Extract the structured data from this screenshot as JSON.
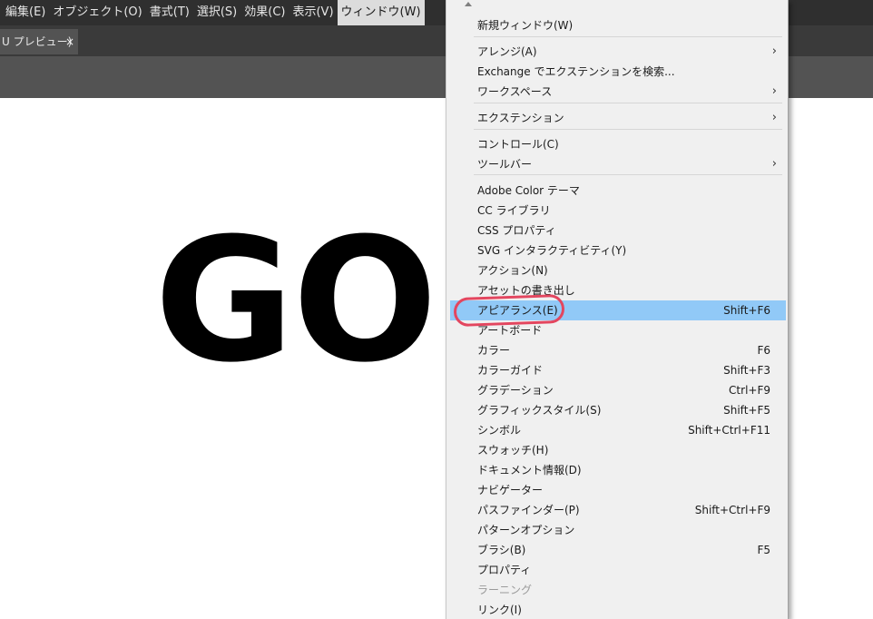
{
  "menubar": {
    "items": [
      "編集(E)",
      "オブジェクト(O)",
      "書式(T)",
      "選択(S)",
      "効果(C)",
      "表示(V)",
      "ウィンドウ(W)"
    ],
    "active_index": 6
  },
  "tab": {
    "label": "U プレビュー)",
    "close": "×"
  },
  "artwork": {
    "text": "GO"
  },
  "menu": [
    {
      "label": "新規ウィンドウ(W)",
      "shortcut": "",
      "submenu": false
    },
    {
      "label": "アレンジ(A)",
      "shortcut": "",
      "submenu": true
    },
    {
      "label": "Exchange でエクステンションを検索...",
      "shortcut": "",
      "submenu": false
    },
    {
      "label": "ワークスペース",
      "shortcut": "",
      "submenu": true
    },
    {
      "label": "エクステンション",
      "shortcut": "",
      "submenu": true
    },
    {
      "label": "コントロール(C)",
      "shortcut": "",
      "submenu": false
    },
    {
      "label": "ツールバー",
      "shortcut": "",
      "submenu": true
    },
    {
      "label": "Adobe Color テーマ",
      "shortcut": "",
      "submenu": false
    },
    {
      "label": "CC ライブラリ",
      "shortcut": "",
      "submenu": false
    },
    {
      "label": "CSS プロパティ",
      "shortcut": "",
      "submenu": false
    },
    {
      "label": "SVG インタラクティビティ(Y)",
      "shortcut": "",
      "submenu": false
    },
    {
      "label": "アクション(N)",
      "shortcut": "",
      "submenu": false
    },
    {
      "label": "アセットの書き出し",
      "shortcut": "",
      "submenu": false
    },
    {
      "label": "アピアランス(E)",
      "shortcut": "Shift+F6",
      "submenu": false,
      "highlight": true
    },
    {
      "label": "アートボード",
      "shortcut": "",
      "submenu": false
    },
    {
      "label": "カラー",
      "shortcut": "F6",
      "submenu": false
    },
    {
      "label": "カラーガイド",
      "shortcut": "Shift+F3",
      "submenu": false
    },
    {
      "label": "グラデーション",
      "shortcut": "Ctrl+F9",
      "submenu": false
    },
    {
      "label": "グラフィックスタイル(S)",
      "shortcut": "Shift+F5",
      "submenu": false
    },
    {
      "label": "シンボル",
      "shortcut": "Shift+Ctrl+F11",
      "submenu": false
    },
    {
      "label": "スウォッチ(H)",
      "shortcut": "",
      "submenu": false
    },
    {
      "label": "ドキュメント情報(D)",
      "shortcut": "",
      "submenu": false
    },
    {
      "label": "ナビゲーター",
      "shortcut": "",
      "submenu": false
    },
    {
      "label": "パスファインダー(P)",
      "shortcut": "Shift+Ctrl+F9",
      "submenu": false
    },
    {
      "label": "パターンオプション",
      "shortcut": "",
      "submenu": false
    },
    {
      "label": "ブラシ(B)",
      "shortcut": "F5",
      "submenu": false
    },
    {
      "label": "プロパティ",
      "shortcut": "",
      "submenu": false
    },
    {
      "label": "ラーニング",
      "shortcut": "",
      "submenu": false,
      "disabled": true
    },
    {
      "label": "リンク(I)",
      "shortcut": "",
      "submenu": false
    }
  ],
  "colors": {
    "menubar_bg": "#2f2f2f",
    "highlight": "#91c9f7",
    "annotation": "#e3465f"
  },
  "icons": {
    "submenu_arrow": "chevron-right-icon",
    "scroll": "scroll-up-arrow-icon",
    "close": "close-icon"
  }
}
